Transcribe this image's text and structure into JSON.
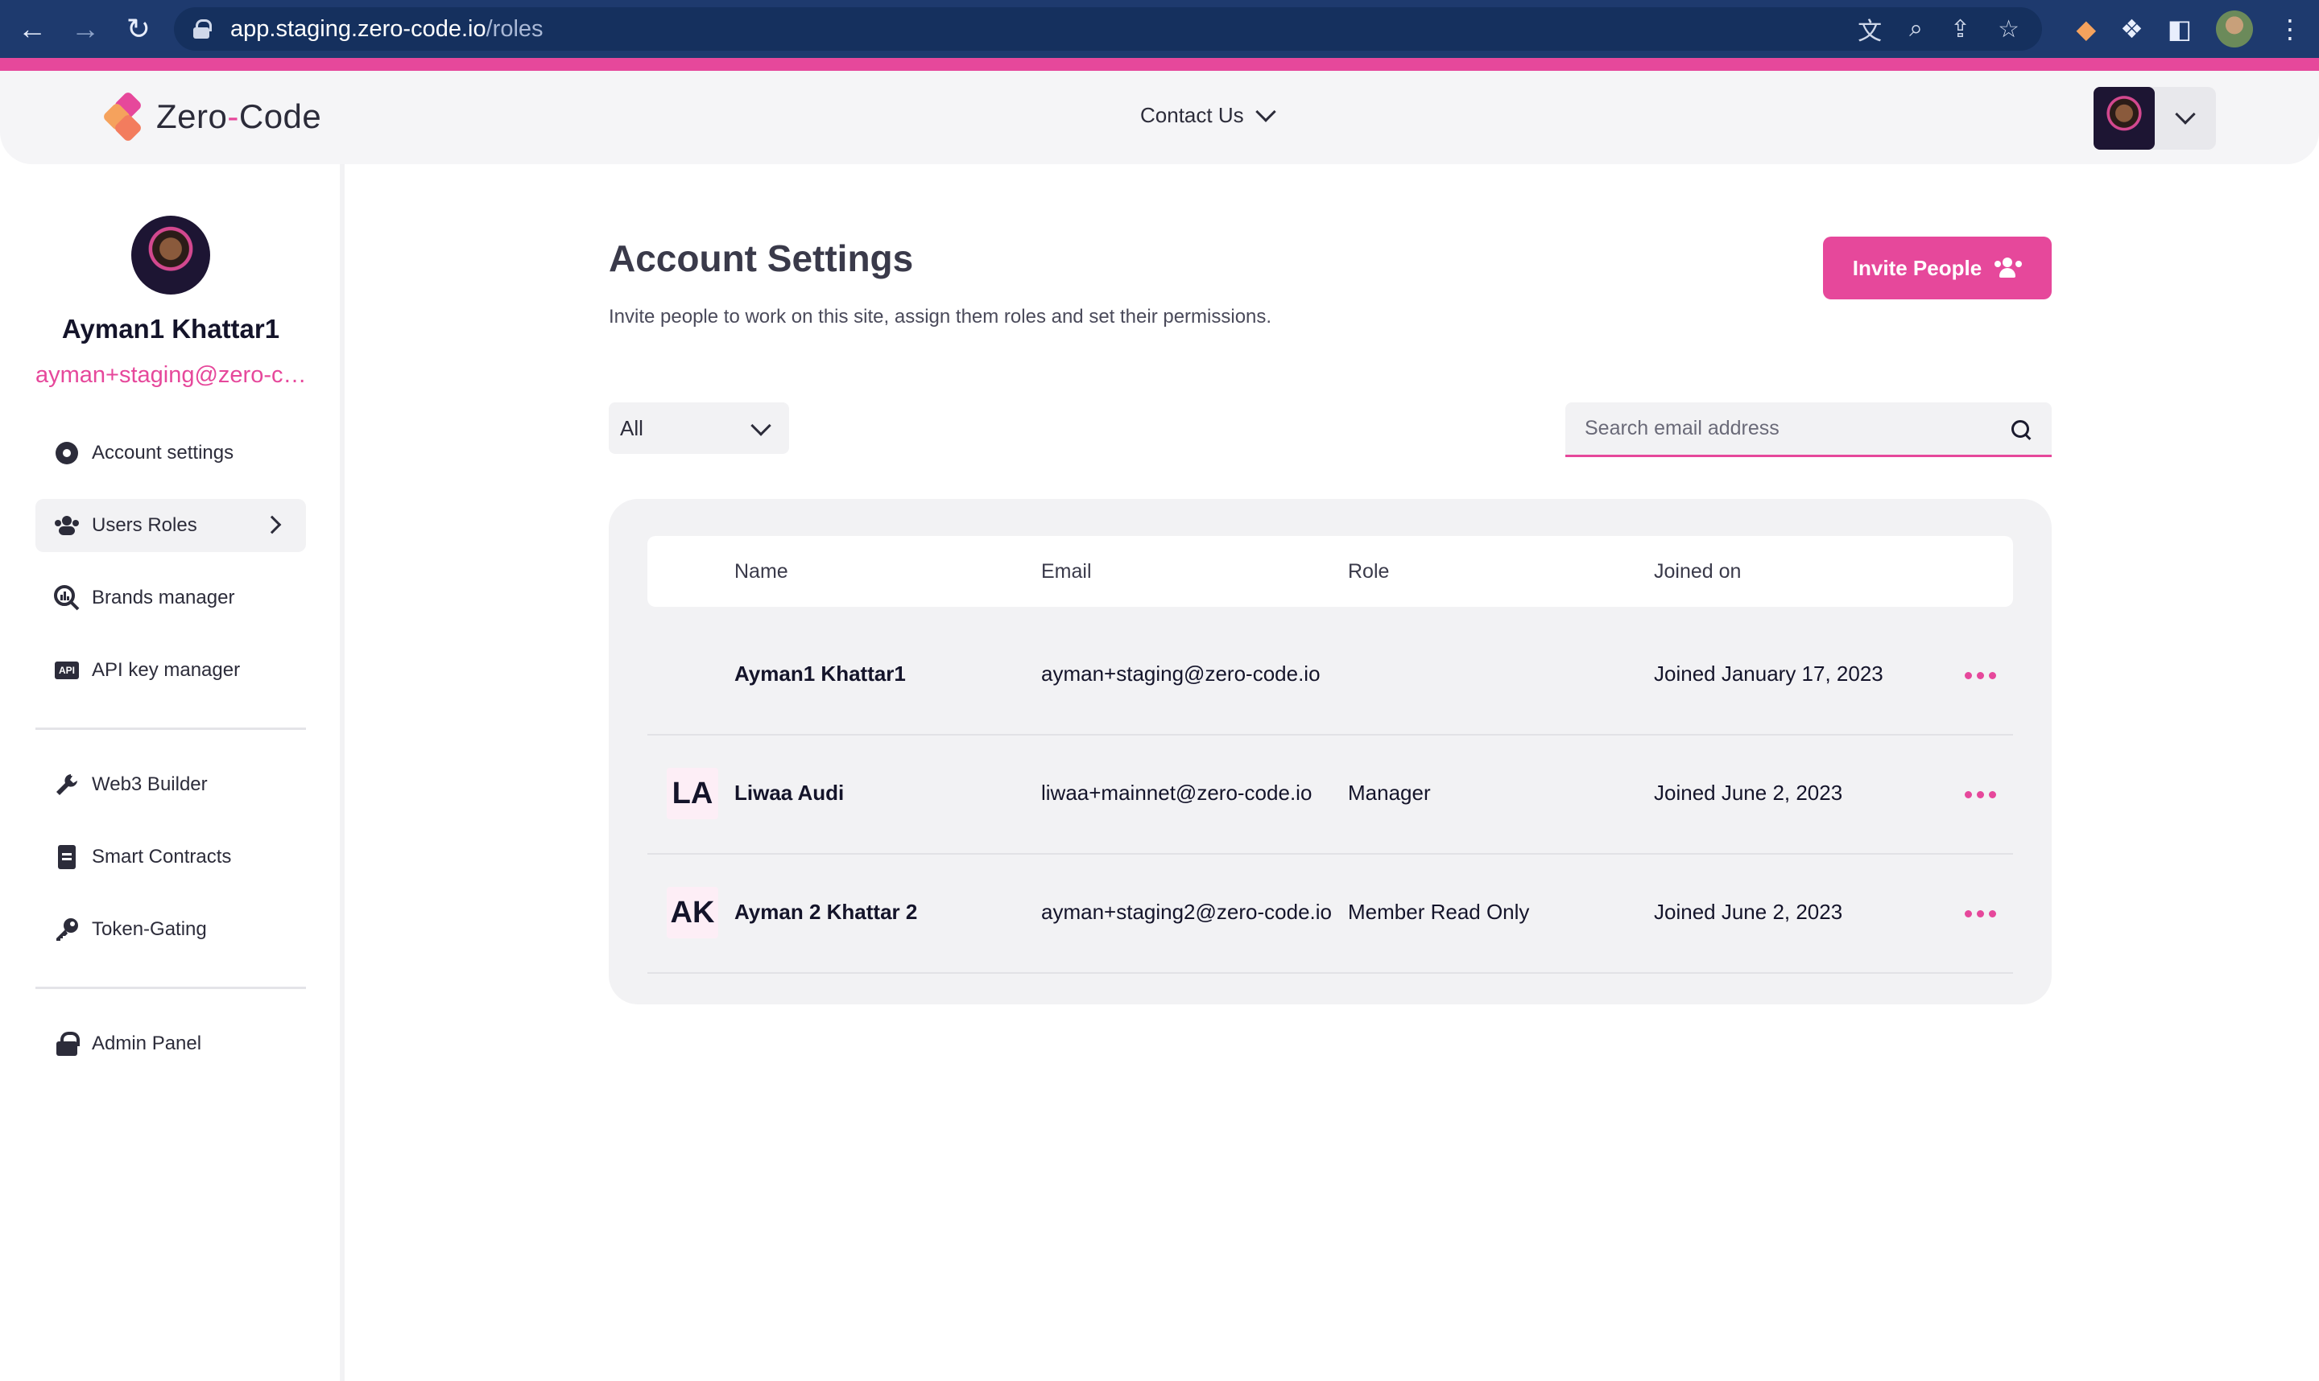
{
  "browser": {
    "url_host": "app.staging.zero-code.io",
    "url_path": "/roles"
  },
  "header": {
    "logo_left": "Zero",
    "logo_dash": "-",
    "logo_right": "Code",
    "contact_label": "Contact Us"
  },
  "profile": {
    "name": "Ayman1 Khattar1",
    "email": "ayman+staging@zero-code.io"
  },
  "sidebar": {
    "items": [
      {
        "label": "Account settings",
        "icon": "gear-icon"
      },
      {
        "label": "Users Roles",
        "icon": "users-icon"
      },
      {
        "label": "Brands manager",
        "icon": "chart-search-icon"
      },
      {
        "label": "API key manager",
        "icon": "api-icon"
      },
      {
        "label": "Web3 Builder",
        "icon": "wrench-icon"
      },
      {
        "label": "Smart Contracts",
        "icon": "document-icon"
      },
      {
        "label": "Token-Gating",
        "icon": "key-icon"
      },
      {
        "label": "Admin Panel",
        "icon": "lock-icon"
      }
    ],
    "active_index": 1
  },
  "main": {
    "title": "Account Settings",
    "subtitle": "Invite people to work on this site, assign them roles and set their permissions.",
    "invite_label": "Invite People",
    "filter_value": "All",
    "search_placeholder": "Search email address",
    "table": {
      "headers": [
        "Name",
        "Email",
        "Role",
        "Joined on"
      ],
      "rows": [
        {
          "initials": "",
          "name": "Ayman1 Khattar1",
          "email": "ayman+staging@zero-code.io",
          "role": "",
          "joined": "Joined January 17, 2023"
        },
        {
          "initials": "LA",
          "name": "Liwaa Audi",
          "email": "liwaa+mainnet@zero-code.io",
          "role": "Manager",
          "joined": "Joined June 2, 2023"
        },
        {
          "initials": "AK",
          "name": "Ayman 2 Khattar 2",
          "email": "ayman+staging2@zero-code.io",
          "role": "Member Read Only",
          "joined": "Joined June 2, 2023"
        }
      ]
    }
  },
  "colors": {
    "accent": "#e6489b",
    "chrome": "#1e3a6e"
  }
}
